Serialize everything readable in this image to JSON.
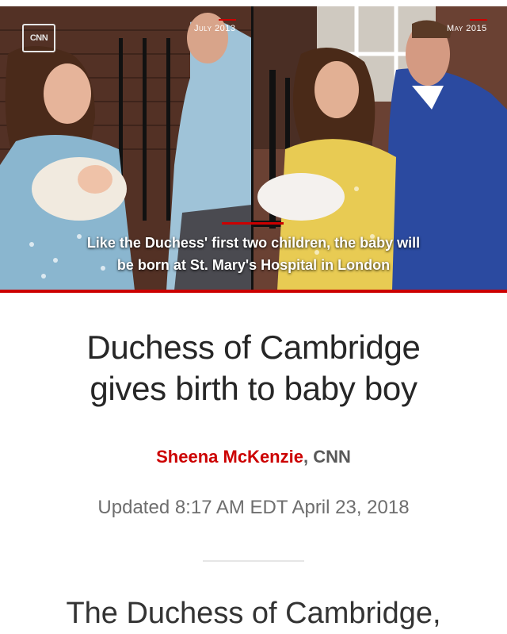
{
  "video": {
    "logo": "CNN",
    "left_date": "July 2013",
    "right_date": "May 2015",
    "caption_line1": "Like the Duchess' first two children, the baby will",
    "caption_line2": "be born at St. Mary's Hospital in London"
  },
  "article": {
    "headline_line1": "Duchess of Cambridge",
    "headline_line2": "gives birth to baby boy",
    "author": "Sheena McKenzie",
    "source_sep": ", ",
    "source": "CNN",
    "updated": "Updated 8:17 AM EDT April 23, 2018",
    "body_start": "The Duchess of Cambridge,"
  },
  "colors": {
    "accent": "#cc0000",
    "headline": "#262626",
    "meta": "#6e6e6e"
  }
}
